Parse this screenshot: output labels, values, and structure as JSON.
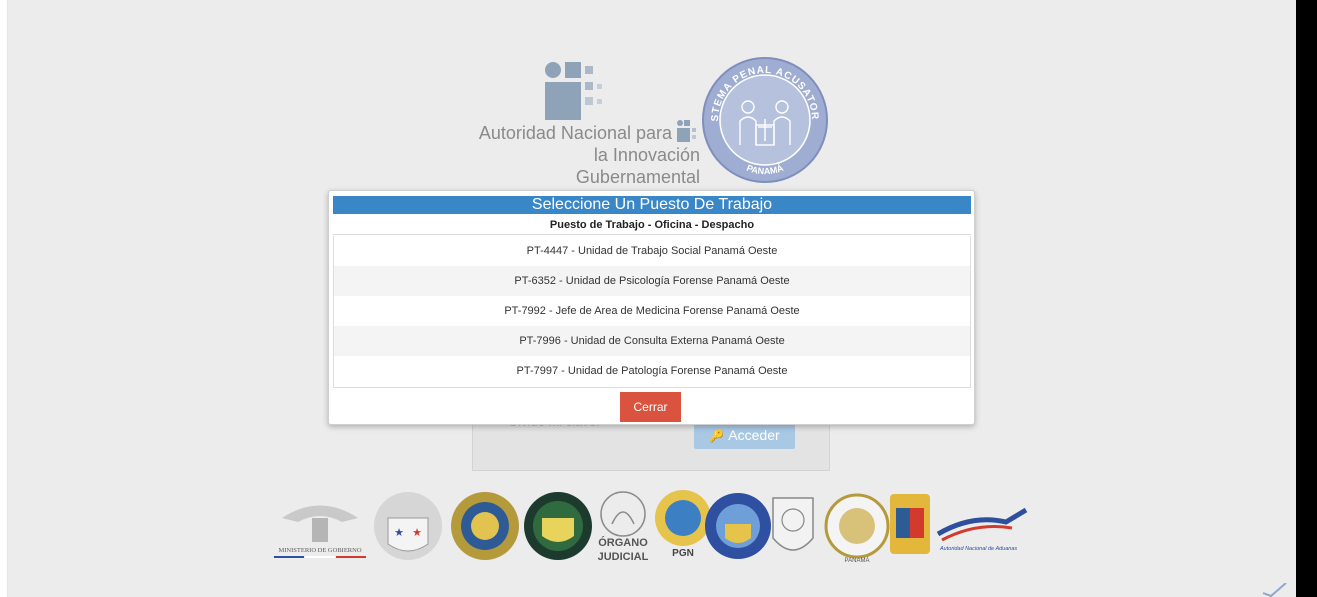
{
  "colors": {
    "accent": "#3a87c8",
    "close_button": "#d9533f",
    "login_button": "#a9c8e4",
    "page_background": "#ececec"
  },
  "header": {
    "aig_name_line1": "Autoridad Nacional para",
    "aig_name_line2": "la Innovación Gubernamental",
    "seal_top": "SISTEMA PENAL ACUSATORIO",
    "seal_bottom": "PANAMÁ"
  },
  "login": {
    "forgot_key": "Olvidé mi clave.",
    "submit_label": "Acceder",
    "submit_icon": "key-icon"
  },
  "modal": {
    "title": "Seleccione Un Puesto De Trabajo",
    "subtitle": "Puesto de Trabajo - Oficina - Despacho",
    "items": [
      {
        "label": "PT-4447 - Unidad de Trabajo Social Panamá Oeste"
      },
      {
        "label": "PT-6352 - Unidad de Psicología Forense Panamá Oeste"
      },
      {
        "label": "PT-7992 - Jefe de Area de Medicina Forense Panamá Oeste"
      },
      {
        "label": "PT-7996 - Unidad de Consulta Externa Panamá Oeste"
      },
      {
        "label": "PT-7997 - Unidad de Patología Forense Panamá Oeste"
      }
    ],
    "close_label": "Cerrar"
  },
  "footer_logos": {
    "ministerio": "MINISTERIO DE GOBIERNO",
    "organo_1": "ÓRGANO",
    "organo_2": "JUDICIAL",
    "pgn": "PGN",
    "panama": "PANAMÁ",
    "aduanas": "Autoridad Nacional de Aduanas"
  }
}
